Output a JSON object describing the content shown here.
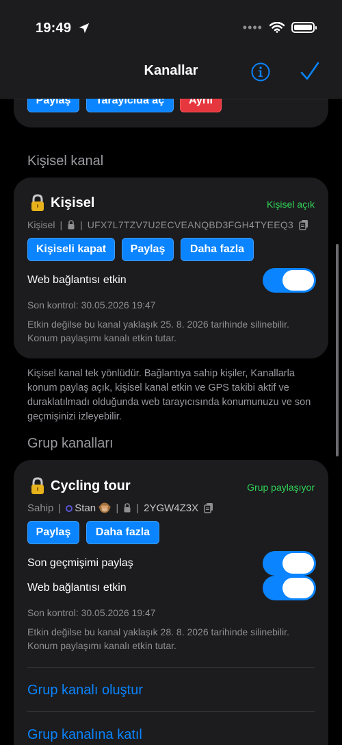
{
  "status_bar": {
    "time": "19:49"
  },
  "nav": {
    "title": "Kanallar"
  },
  "top_card": {
    "share_label": "Paylaş",
    "browser_label": "Tarayıcıda aç",
    "leave_label": "Ayrıl"
  },
  "personal_section": {
    "header": "Kişisel kanal",
    "card": {
      "title": "Kişisel",
      "status": "Kişisel açık",
      "meta_owner": "Kişisel",
      "code": "UFX7L7TZV7U2ECVEANQBD3FGH4TYEEQ3",
      "buttons": {
        "close": "Kişiseli kapat",
        "share": "Paylaş",
        "more": "Daha fazla"
      },
      "web_link_label": "Web bağlantısı etkin",
      "last_check": "Son kontrol: 30.05.2026 19:47",
      "note": "Etkin değilse bu kanal yaklaşık 25. 8. 2026 tarihinde silinebilir. Konum paylaşımı kanalı etkin tutar."
    },
    "description": "Kişisel kanal tek yönlüdür. Bağlantıya sahip kişiler, Kanallarla konum paylaş açık, kişisel kanal etkin ve GPS takibi aktif ve duraklatılmadı olduğunda web tarayıcısında konumunuzu ve son geçmişinizi izleyebilir."
  },
  "group_section": {
    "header": "Grup kanalları",
    "card": {
      "title": "Cycling tour",
      "status": "Grup paylaşıyor",
      "meta_owner": "Sahip",
      "member": "Stan",
      "code": "2YGW4Z3X",
      "buttons": {
        "share": "Paylaş",
        "more": "Daha fazla"
      },
      "history_label": "Son geçmişimi paylaş",
      "web_link_label": "Web bağlantısı etkin",
      "last_check": "Son kontrol: 30.05.2026 19:47",
      "note": "Etkin değilse bu kanal yaklaşık 28. 8. 2026 tarihinde silinebilir. Konum paylaşımı kanalı etkin tutar.",
      "create_link": "Grup kanalı oluştur",
      "join_link": "Grup kanalına katıl"
    }
  },
  "colors": {
    "accent": "#0a84ff",
    "green": "#30d158",
    "red": "#e5373d",
    "card_bg": "#1c1c1e"
  },
  "icons": [
    "location-arrow-icon",
    "wifi-icon",
    "battery-icon",
    "info-icon",
    "checkmark-icon",
    "lock-icon",
    "copy-icon",
    "monkey-emoji-icon"
  ]
}
